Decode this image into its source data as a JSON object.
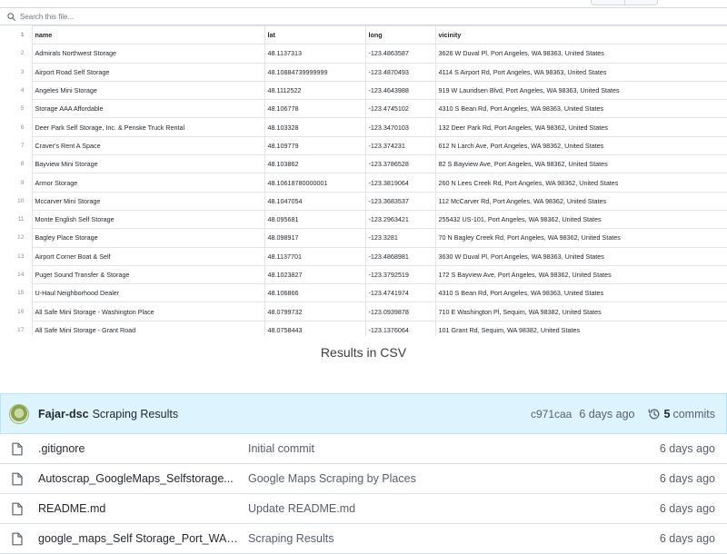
{
  "search": {
    "placeholder": "Search this file..."
  },
  "csv": {
    "header": [
      "name",
      "lat",
      "long",
      "vicinity"
    ],
    "header_row_number": "1",
    "rows": [
      {
        "n": "2",
        "name": "Admirals Northwest Storage",
        "lat": "48.1137313",
        "long": "-123.4863587",
        "vicinity": "3626 W Duval Pl, Port Angeles, WA 98363, United States"
      },
      {
        "n": "3",
        "name": "Airport Road Self Storage",
        "lat": "48.10884739999999",
        "long": "-123.4870493",
        "vicinity": "4114 S Airport Rd, Port Angeles, WA 98363, United States"
      },
      {
        "n": "4",
        "name": "Angeles Mini Storage",
        "lat": "48.1112522",
        "long": "-123.4643988",
        "vicinity": "919 W Lauridsen Blvd, Port Angeles, WA 98363, United States"
      },
      {
        "n": "5",
        "name": "Storage AAA Affordable",
        "lat": "48.106778",
        "long": "-123.4745102",
        "vicinity": "4310 S Bean Rd, Port Angeles, WA 98363, United States"
      },
      {
        "n": "6",
        "name": "Deer Park Self Storage, Inc. & Penske Truck Rental",
        "lat": "48.103328",
        "long": "-123.3470103",
        "vicinity": "132 Deer Park Rd, Port Angeles, WA 98362, United States"
      },
      {
        "n": "7",
        "name": "Craver's Rent A Space",
        "lat": "48.109779",
        "long": "-123.374231",
        "vicinity": "612 N Larch Ave, Port Angeles, WA 98362, United States"
      },
      {
        "n": "8",
        "name": "Bayview Mini Storage",
        "lat": "48.103862",
        "long": "-123.3786528",
        "vicinity": "82 S Bayview Ave, Port Angeles, WA 98362, United States"
      },
      {
        "n": "9",
        "name": "Armor Storage",
        "lat": "48.10618780000001",
        "long": "-123.3819064",
        "vicinity": "260 N Lees Creek Rd, Port Angeles, WA 98362, United States"
      },
      {
        "n": "10",
        "name": "Mccarver Mini Storage",
        "lat": "48.1047054",
        "long": "-123.3683537",
        "vicinity": "112 McCarver Rd, Port Angeles, WA 98362, United States"
      },
      {
        "n": "11",
        "name": "Monte English Self Storage",
        "lat": "48.095681",
        "long": "-123.2963421",
        "vicinity": "255432 US-101, Port Angeles, WA 98362, United States"
      },
      {
        "n": "12",
        "name": "Bagley Place Storage",
        "lat": "48.098917",
        "long": "-123.3281",
        "vicinity": "70 N Bagley Creek Rd, Port Angeles, WA 98362, United States"
      },
      {
        "n": "13",
        "name": "Airport Corner Boat & Self",
        "lat": "48.1137701",
        "long": "-123.4868981",
        "vicinity": "3630 W Duval Pl, Port Angeles, WA 98363, United States"
      },
      {
        "n": "14",
        "name": "Puget Sound Transfer & Storage",
        "lat": "48.1023827",
        "long": "-123.3792519",
        "vicinity": "172 S Bayview Ave, Port Angeles, WA 98362, United States"
      },
      {
        "n": "15",
        "name": "U-Haul Neighborhood Dealer",
        "lat": "48.106866",
        "long": "-123.4741974",
        "vicinity": "4310 S Bean Rd, Port Angeles, WA 98363, United States"
      },
      {
        "n": "16",
        "name": "All Safe Mini Storage - Washington Place",
        "lat": "48.0799732",
        "long": "-123.0939878",
        "vicinity": "710 E Washington Pl, Sequim, WA 98382, United States"
      },
      {
        "n": "17",
        "name": "All Safe Mini Storage - Grant Road",
        "lat": "48.0758443",
        "long": "-123.1376064",
        "vicinity": "101 Grant Rd, Sequim, WA 98382, United States"
      }
    ]
  },
  "caption": "Results in CSV",
  "repo": {
    "author": "Fajar-dsc",
    "commit_message": "Scraping Results",
    "sha": "c971caa",
    "ago": "6 days ago",
    "commits_count": "5",
    "commits_label": "commits",
    "files": [
      {
        "name": ".gitignore",
        "message": "Initial commit",
        "age": "6 days ago"
      },
      {
        "name": "Autoscrap_GoogleMaps_Selfstorage...",
        "message": "Google Maps Scraping by Places",
        "age": "6 days ago"
      },
      {
        "name": "README.md",
        "message": "Update README.md",
        "age": "6 days ago"
      },
      {
        "name": "google_maps_Self Storage_Port_WA.csv",
        "message": "Scraping Results",
        "age": "6 days ago"
      }
    ]
  },
  "icons": {
    "search": "search-icon",
    "history": "history-icon",
    "file": "file-icon",
    "avatar": "avatar"
  },
  "colors": {
    "repo_header_bg": "#ddf4ff",
    "border": "#d0d7de",
    "muted": "#57606a"
  }
}
